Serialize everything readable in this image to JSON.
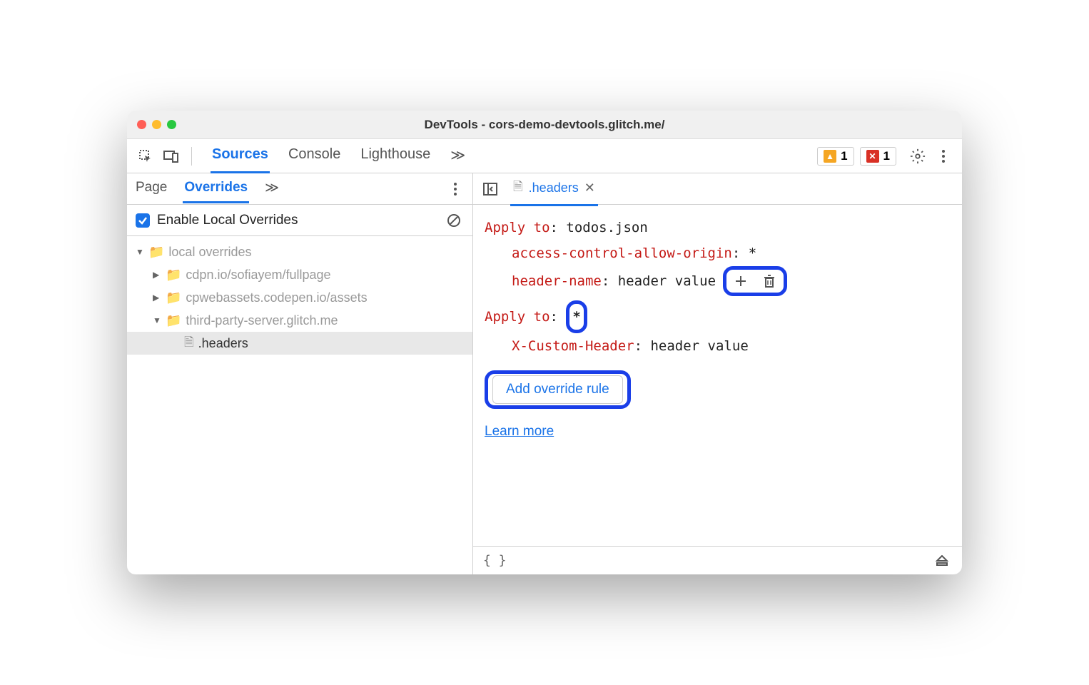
{
  "window": {
    "title": "DevTools - cors-demo-devtools.glitch.me/"
  },
  "main_tabs": {
    "sources": "Sources",
    "console": "Console",
    "lighthouse": "Lighthouse"
  },
  "badges": {
    "warning_count": "1",
    "error_count": "1"
  },
  "sidebar": {
    "subtabs": {
      "page": "Page",
      "overrides": "Overrides"
    },
    "enable_label": "Enable Local Overrides",
    "tree": {
      "root": "local overrides",
      "items": [
        "cdpn.io/sofiayem/fullpage",
        "cpwebassets.codepen.io/assets",
        "third-party-server.glitch.me"
      ],
      "file": ".headers"
    }
  },
  "editor": {
    "tab_name": ".headers",
    "rules": [
      {
        "apply_label": "Apply to",
        "apply_value": "todos.json",
        "headers": [
          {
            "name": "access-control-allow-origin",
            "value": "*"
          },
          {
            "name": "header-name",
            "value": "header value"
          }
        ]
      },
      {
        "apply_label": "Apply to",
        "apply_value": "*",
        "headers": [
          {
            "name": "X-Custom-Header",
            "value": "header value"
          }
        ]
      }
    ],
    "add_rule": "Add override rule",
    "learn_more": "Learn more"
  },
  "footer": {
    "braces": "{ }"
  }
}
